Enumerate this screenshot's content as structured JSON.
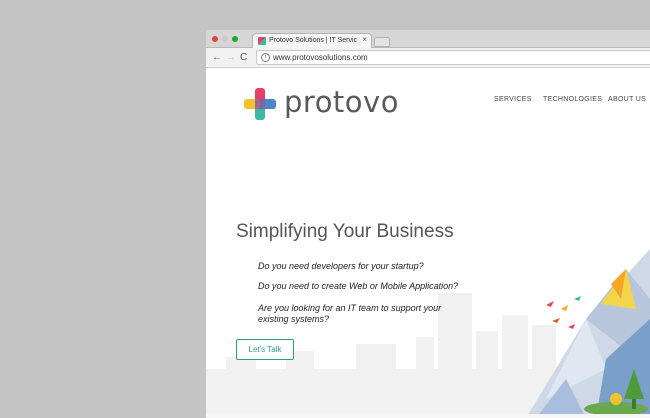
{
  "browser": {
    "tab_title": "Protovo Solutions | IT Services",
    "tab_close": "×",
    "url": "www.protovosolutions.com",
    "nav_back": "←",
    "nav_forward": "→",
    "nav_reload": "C",
    "omni_icon": "i"
  },
  "site": {
    "logo_text": "protovo",
    "nav": [
      "SERVICES",
      "TECHNOLOGIES",
      "ABOUT US"
    ],
    "hero_title": "Simplifying Your Business",
    "questions": [
      "Do you need developers for your startup?",
      "Do you need to create Web or Mobile Application?",
      "Are you looking for an IT team to support your",
      "existing systems?"
    ],
    "cta": "Let's Talk",
    "colors": {
      "accent": "#2a9d8f",
      "logo_red": "#e8415f",
      "logo_yellow": "#f2c12e",
      "logo_teal": "#3eb7a3",
      "logo_blue": "#4a86c8"
    }
  }
}
